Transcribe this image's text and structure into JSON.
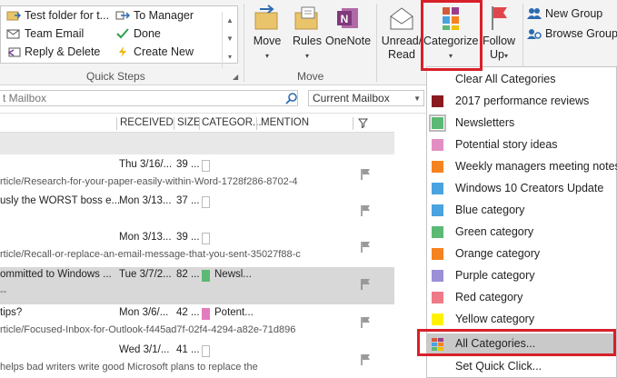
{
  "quick_steps": {
    "items": [
      {
        "label": "Test folder for t...",
        "icon": "folder-arrow-icon"
      },
      {
        "label": "To Manager",
        "icon": "arrow-right-icon"
      },
      {
        "label": "Team Email",
        "icon": "email-icon"
      },
      {
        "label": "Done",
        "icon": "checkmark-icon"
      },
      {
        "label": "Reply & Delete",
        "icon": "reply-icon"
      },
      {
        "label": "Create New",
        "icon": "lightning-icon"
      }
    ],
    "group_label": "Quick Steps"
  },
  "move_group": {
    "label": "Move",
    "buttons": [
      {
        "label": "Move",
        "caret": "▾"
      },
      {
        "label": "Rules",
        "caret": "▾"
      },
      {
        "label": "OneNote"
      }
    ]
  },
  "tags_group": {
    "unread": {
      "line1": "Unread/",
      "line2": "Read"
    },
    "categorize": {
      "label": "Categorize",
      "caret": "▾"
    },
    "follow_up": {
      "line1": "Follow",
      "line2": "Up",
      "caret": "▾"
    }
  },
  "groups": {
    "new_group": "New Group",
    "browse_groups": "Browse Groups"
  },
  "search": {
    "placeholder": "t Mailbox",
    "scope": "Current Mailbox"
  },
  "columns": {
    "received": "RECEIVED",
    "size": "SIZE",
    "categories": "CATEGOR...",
    "mention": "MENTION"
  },
  "messages": [
    {
      "subject": "",
      "received": "Thu 3/16/...",
      "size": "39 ...",
      "preview": "rticle/Research-for-your-paper-easily-within-Word-1728f286-8702-4",
      "category": "",
      "category_color": ""
    },
    {
      "subject": "usly the WORST boss e...",
      "received": "Mon 3/13...",
      "size": "37 ...",
      "preview": "",
      "category": "",
      "category_color": ""
    },
    {
      "subject": "",
      "received": "Mon 3/13...",
      "size": "39 ...",
      "preview": "rticle/Recall-or-replace-an-email-message-that-you-sent-35027f88-c",
      "category": "",
      "category_color": ""
    },
    {
      "subject": "ommitted to Windows ...",
      "received": "Tue 3/7/2...",
      "size": "82 ...",
      "preview": "--",
      "category": "Newsl...",
      "category_color": "#5bb974"
    },
    {
      "subject": " tips?",
      "received": "Mon 3/6/...",
      "size": "42 ...",
      "preview": "rticle/Focused-Inbox-for-Outlook-f445ad7f-02f4-4294-a82e-71d896",
      "category": "Potent...",
      "category_color": "#e37bbf"
    },
    {
      "subject": "",
      "received": "Wed 3/1/...",
      "size": "41 ...",
      "preview": " helps bad writers write good  Microsoft plans to replace the",
      "category": "",
      "category_color": ""
    }
  ],
  "category_menu": {
    "clear_all": "Clear All Categories",
    "items": [
      {
        "label": "2017 performance reviews",
        "color": "#8a1a1f"
      },
      {
        "label": "Newsletters",
        "color": "#5bb974"
      },
      {
        "label": "Potential story ideas",
        "color": "#e38ec3"
      },
      {
        "label": "Weekly managers meeting notes",
        "color": "#f58220"
      },
      {
        "label": "Windows 10 Creators Update",
        "color": "#4aa3df"
      },
      {
        "label": "Blue category",
        "color": "#4aa3df"
      },
      {
        "label": "Green category",
        "color": "#5bb974"
      },
      {
        "label": "Orange category",
        "color": "#f58220"
      },
      {
        "label": "Purple category",
        "color": "#9b8fd8"
      },
      {
        "label": "Red category",
        "color": "#ee7a87"
      },
      {
        "label": "Yellow category",
        "color": "#fff200"
      }
    ],
    "all_categories": "All Categories...",
    "set_quick_click": "Set Quick Click..."
  },
  "colors": {
    "highlight": "#d8202a",
    "onenote": "#80397b"
  }
}
